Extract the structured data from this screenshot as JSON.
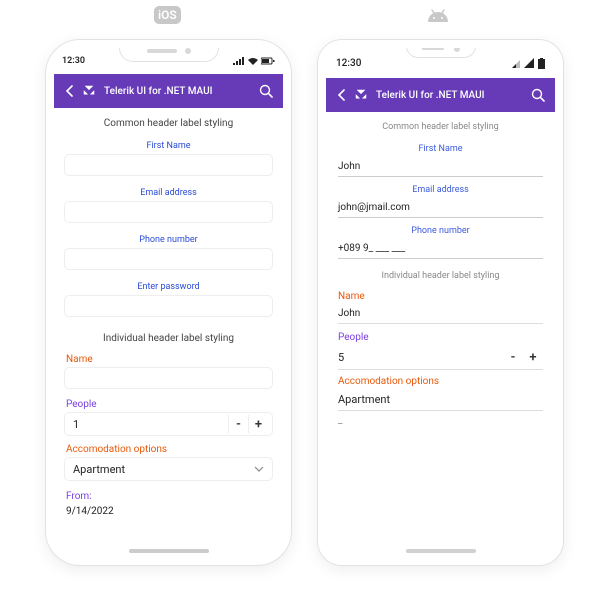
{
  "platforms": {
    "ios": "iOS",
    "android": "Android"
  },
  "status": {
    "ios": {
      "time": "12:30"
    },
    "android": {
      "time": "12:30"
    }
  },
  "appbar": {
    "title": "Telerik UI for .NET MAUI"
  },
  "headers": {
    "common": "Common header label styling",
    "individual": "Individual header label styling"
  },
  "commonFields": {
    "firstName": {
      "label": "First Name"
    },
    "email": {
      "label": "Email address"
    },
    "phone": {
      "label": "Phone number"
    },
    "password": {
      "label": "Enter password"
    }
  },
  "individualFields": {
    "name": {
      "label": "Name"
    },
    "people": {
      "label": "People"
    },
    "accommodation": {
      "label": "Accomodation options"
    },
    "from": {
      "label": "From:"
    }
  },
  "ios": {
    "firstName": "",
    "email": "",
    "phone": "",
    "password": "",
    "name": "",
    "people": "1",
    "accommodation": "Apartment",
    "from": "9/14/2022"
  },
  "android": {
    "firstName": "John",
    "email": "john@jmail.com",
    "phone": "+089 9_ ___ ___",
    "password": "",
    "name": "John",
    "people": "5",
    "accommodation": "Apartment",
    "extra": "_"
  },
  "stepper": {
    "minus": "-",
    "plus": "+"
  },
  "colors": {
    "accent": "#673AB7",
    "link": "#2a4bd7",
    "orange": "#e8590c",
    "purple": "#7b3fe4"
  }
}
